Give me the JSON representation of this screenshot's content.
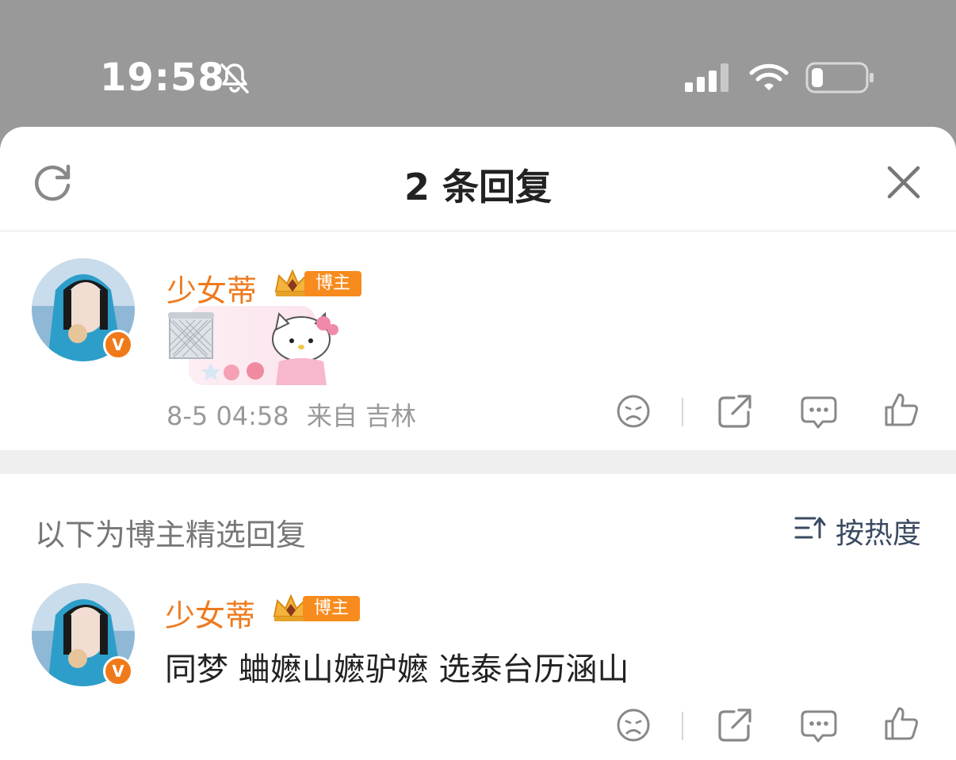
{
  "status_bar": {
    "time": "19:58",
    "icons": [
      "bell-slash-icon",
      "cellular-signal-icon",
      "wifi-icon",
      "battery-icon"
    ]
  },
  "sheet": {
    "title": "2 条回复",
    "refresh_icon": "refresh-icon",
    "close_icon": "close-icon"
  },
  "main_comment": {
    "username": "少女蒂",
    "badge_level": "6",
    "badge_label": "博主",
    "content_sticker": "trash-can-hello-kitty-sticker",
    "timestamp": "8-5 04:58",
    "location": "来自 吉林",
    "actions": [
      "dislike-icon",
      "share-icon",
      "comment-icon",
      "like-icon"
    ]
  },
  "section": {
    "label": "以下为博主精选回复",
    "sort_label": "按热度"
  },
  "reply": {
    "username": "少女蒂",
    "badge_level": "6",
    "badge_label": "博主",
    "text": "同梦 蛐嬷山嬷驴嬷 选泰台历涵山",
    "actions": [
      "dislike-icon",
      "share-icon",
      "comment-icon",
      "like-icon"
    ]
  },
  "colors": {
    "accent": "#ee7a1e",
    "badge": "#f78b1d",
    "muted_text": "#999999",
    "status_bar_bg": "#999999"
  }
}
